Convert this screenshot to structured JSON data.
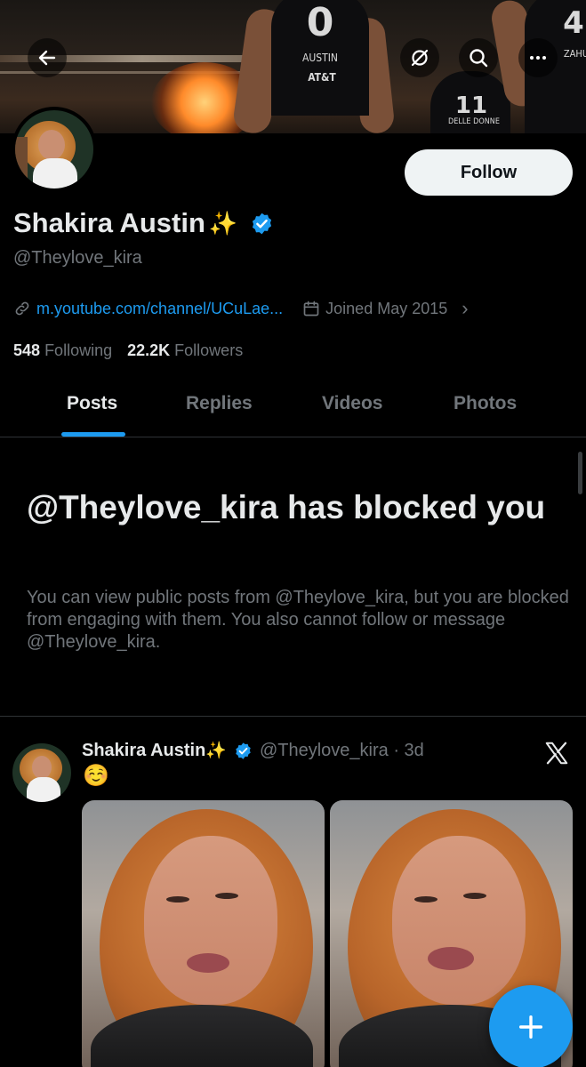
{
  "banner": {
    "jersey_left_number": "0",
    "jersey_left_name": "AUSTIN",
    "jersey_left_sponsor": "AT&T",
    "jersey_mid_number": "11",
    "jersey_mid_name": "DELLE DONNE",
    "jersey_right_number": "4",
    "jersey_right_name": "ZAHU"
  },
  "icons": {
    "back": "back-arrow-icon",
    "grok": "grok-icon",
    "search": "search-icon",
    "more": "more-icon",
    "link": "link-icon",
    "calendar": "calendar-icon",
    "verified": "verified-badge-icon",
    "x_logo": "x-logo-icon",
    "compose": "plus-icon"
  },
  "profile": {
    "follow_label": "Follow",
    "name": "Shakira Austin",
    "name_emoji": "✨",
    "handle": "@Theylove_kira",
    "link": "m.youtube.com/channel/UCuLae...",
    "joined": "Joined May 2015",
    "following_count": "548",
    "following_label": "Following",
    "followers_count": "22.2K",
    "followers_label": "Followers"
  },
  "tabs": [
    {
      "label": "Posts"
    },
    {
      "label": "Replies"
    },
    {
      "label": "Videos"
    },
    {
      "label": "Photos"
    }
  ],
  "blocked": {
    "title": "@Theylove_kira has blocked you",
    "body": "You can view public posts from @Theylove_kira, but you are blocked from engaging with them. You also cannot follow or message @Theylove_kira."
  },
  "post": {
    "name": "Shakira Austin",
    "name_emoji": "✨",
    "handle_time": "@Theylove_kira · 3d",
    "text": "☺️"
  },
  "colors": {
    "accent": "#1d9bf0",
    "background": "#000000",
    "secondary_text": "#71767b",
    "primary_text": "#e7e9ea"
  }
}
